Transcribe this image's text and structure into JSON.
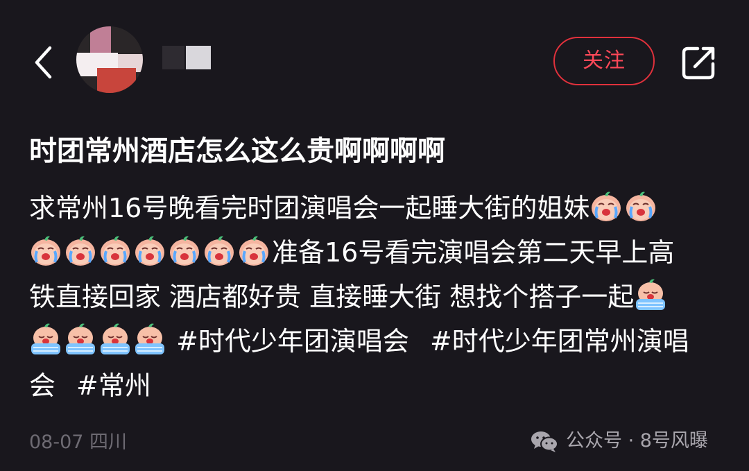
{
  "header": {
    "follow_label": "关注"
  },
  "post": {
    "title": "时团常州酒店怎么这么贵啊啊啊啊",
    "text_1": "求常州16号晚看完时团演唱会一起睡大街的姐妹",
    "text_2": "准备16号看完演唱会第二天早上高",
    "text_3": "铁直接回家 酒店都好贵 直接睡大街 想找个搭子一起",
    "hashtags": [
      "#时代少年团演唱会",
      "#时代少年团常州演唱",
      "会",
      "#常州"
    ]
  },
  "meta": {
    "date_location": "08-07 四川"
  },
  "watermark": {
    "text": "公众号 · 8号风曝"
  },
  "icons": {
    "back": "chevron-left-icon",
    "share": "share-external-icon",
    "crying_emoji": "crying-face-emoji",
    "sobbing_emoji": "sobbing-face-emoji",
    "wechat": "wechat-icon"
  },
  "colors": {
    "background": "#19171d",
    "follow_accent": "#e0313c",
    "text": "#ffffff",
    "meta": "#6e6b73"
  }
}
